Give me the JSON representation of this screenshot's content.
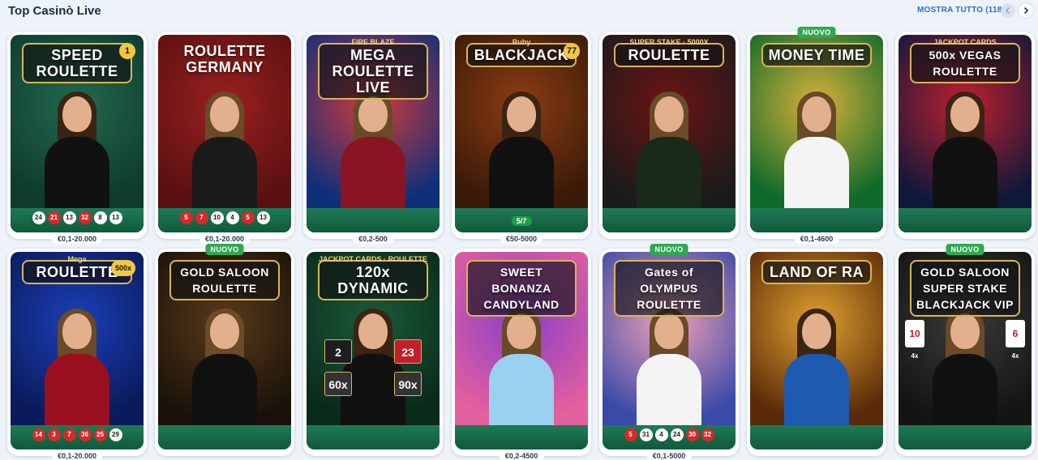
{
  "header": {
    "title": "Top Casinò Live",
    "show_all": "MOSTRA TUTTO (118)"
  },
  "icons": {
    "prev": "chevron-left-icon",
    "next": "chevron-right-icon"
  },
  "new_badge_label": "NUOVO",
  "games": [
    {
      "title": "SPEED ROULETTE",
      "bet": "€0,1-20.000",
      "new": false,
      "results": [
        [
          "24",
          "black"
        ],
        [
          "21",
          "red"
        ],
        [
          "13",
          "black"
        ],
        [
          "32",
          "red"
        ],
        [
          "8",
          "black"
        ],
        [
          "13",
          "black"
        ]
      ],
      "multiplier": "1",
      "bg": "#0e3b2e",
      "accent": "#23694d",
      "outfit": "#111111"
    },
    {
      "title": "ROULETTE GERMANY",
      "bet": "€0,1-20.000",
      "new": false,
      "results": [
        [
          "5",
          "red"
        ],
        [
          "7",
          "red"
        ],
        [
          "10",
          "black"
        ],
        [
          "4",
          "black"
        ],
        [
          "5",
          "red"
        ],
        [
          "13",
          "black"
        ]
      ],
      "bg": "#5a1010",
      "accent": "#9b2020",
      "outfit": "#1a1a1a"
    },
    {
      "title": "MEGA ROULETTE LIVE",
      "sub": "FIRE BLAZE",
      "bet": "€0,2-500",
      "new": false,
      "bg": "#0e2f7a",
      "accent": "#d23a3a",
      "outfit": "#8a1424"
    },
    {
      "title": "BLACKJACK",
      "sub": "Ruby",
      "bet": "€50-5000",
      "new": false,
      "seats": "5/7",
      "multiplier": "77",
      "bg": "#3a1a08",
      "accent": "#8c3d12",
      "outfit": "#111111"
    },
    {
      "title": "ROULETTE",
      "sub": "SUPER STAKE · 5000X",
      "bet": "",
      "new": false,
      "bg": "#1b1b1b",
      "accent": "#6a1414",
      "outfit": "#1a2a1a"
    },
    {
      "title": "MONEY TIME",
      "bet": "€0,1-4600",
      "new": true,
      "bg": "#0f6a2a",
      "accent": "#d8b13a",
      "outfit": "#f4f4f4"
    },
    {
      "title": "500x VEGAS ROULETTE",
      "sub": "JACKPOT CARDS",
      "bet": "",
      "new": false,
      "bg": "#10183a",
      "accent": "#c0202e",
      "outfit": "#111111"
    },
    {
      "title": "ROULETTE",
      "sub": "Mega",
      "bet": "€0,1-20.000",
      "new": false,
      "results": [
        [
          "14",
          "red"
        ],
        [
          "3",
          "red"
        ],
        [
          "7",
          "red"
        ],
        [
          "36",
          "red"
        ],
        [
          "25",
          "red"
        ],
        [
          "29",
          "black"
        ]
      ],
      "multiplier": "500x",
      "bg": "#0a1a5a",
      "accent": "#1b3fb8",
      "outfit": "#9b1020"
    },
    {
      "title": "GOLD SALOON ROULETTE",
      "bet": "",
      "new": true,
      "bg": "#1a120a",
      "accent": "#5a3a18",
      "outfit": "#111111"
    },
    {
      "title": "120x DYNAMIC",
      "sub": "JACKPOT CARDS · ROULETTE",
      "bet": "",
      "new": false,
      "tiles": [
        "2",
        "23",
        "60x",
        "90x"
      ],
      "bg": "#0a2a1a",
      "accent": "#1b5a3a",
      "outfit": "#111111"
    },
    {
      "title": "SWEET BONANZA CANDYLAND",
      "bet": "€0,2-4500",
      "new": false,
      "bg": "#e4609e",
      "accent": "#8b3fc9",
      "outfit": "#9ad0f0"
    },
    {
      "title": "Gates of OLYMPUS ROULETTE",
      "bet": "€0,1-5000",
      "new": true,
      "results": [
        [
          "5",
          "red"
        ],
        [
          "31",
          "black"
        ],
        [
          "4",
          "black"
        ],
        [
          "24",
          "black"
        ],
        [
          "30",
          "red"
        ],
        [
          "32",
          "red"
        ]
      ],
      "bg": "#3a4aa8",
      "accent": "#f2a0b8",
      "outfit": "#f4f4f4"
    },
    {
      "title": "LAND OF RA",
      "bet": "",
      "new": false,
      "bg": "#5a2a08",
      "accent": "#e0a030",
      "outfit": "#1e5ab0"
    },
    {
      "title": "GOLD SALOON SUPER STAKE BLACKJACK VIP",
      "bet": "",
      "new": true,
      "cards": [
        "10",
        "6",
        "4x",
        "4x"
      ],
      "bg": "#141414",
      "accent": "#3a3a3a",
      "outfit": "#111111"
    }
  ]
}
